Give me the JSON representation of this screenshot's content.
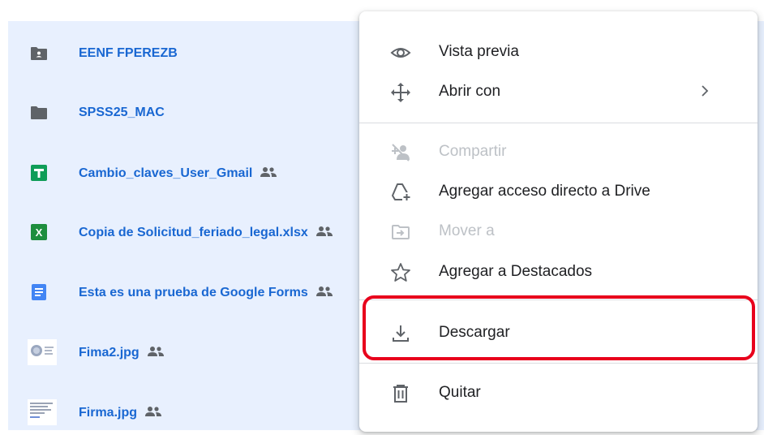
{
  "files": [
    {
      "name": "EENF FPEREZB",
      "icon": "shared-folder-icon",
      "shared": false
    },
    {
      "name": "SPSS25_MAC",
      "icon": "folder-icon",
      "shared": false
    },
    {
      "name": "Cambio_claves_User_Gmail",
      "icon": "google-sheets-icon",
      "shared": true
    },
    {
      "name": "Copia de Solicitud_feriado_legal.xlsx",
      "icon": "excel-icon",
      "shared": true
    },
    {
      "name": "Esta es una prueba de Google Forms",
      "icon": "google-docs-icon",
      "shared": true
    },
    {
      "name": "Fima2.jpg",
      "icon": "image-thumbnail-icon",
      "shared": true
    },
    {
      "name": "Firma.jpg",
      "icon": "image-thumbnail-icon",
      "shared": true
    }
  ],
  "menu": {
    "items": [
      {
        "label": "Vista previa",
        "icon": "eye-icon",
        "enabled": true
      },
      {
        "label": "Abrir con",
        "icon": "move-arrows-icon",
        "enabled": true,
        "submenu": true
      },
      {
        "label": "Compartir",
        "icon": "add-person-icon",
        "enabled": false
      },
      {
        "label": "Agregar acceso directo a Drive",
        "icon": "drive-shortcut-icon",
        "enabled": true
      },
      {
        "label": "Mover a",
        "icon": "folder-move-icon",
        "enabled": false
      },
      {
        "label": "Agregar a Destacados",
        "icon": "star-outline-icon",
        "enabled": true
      },
      {
        "label": "Descargar",
        "icon": "download-icon",
        "enabled": true
      },
      {
        "label": "Quitar",
        "icon": "trash-icon",
        "enabled": true
      }
    ]
  },
  "colors": {
    "selection_background": "#e8f0fe",
    "file_name": "#1967d2",
    "highlight_border": "#e8001c",
    "disabled_text": "#bdc1c6"
  }
}
